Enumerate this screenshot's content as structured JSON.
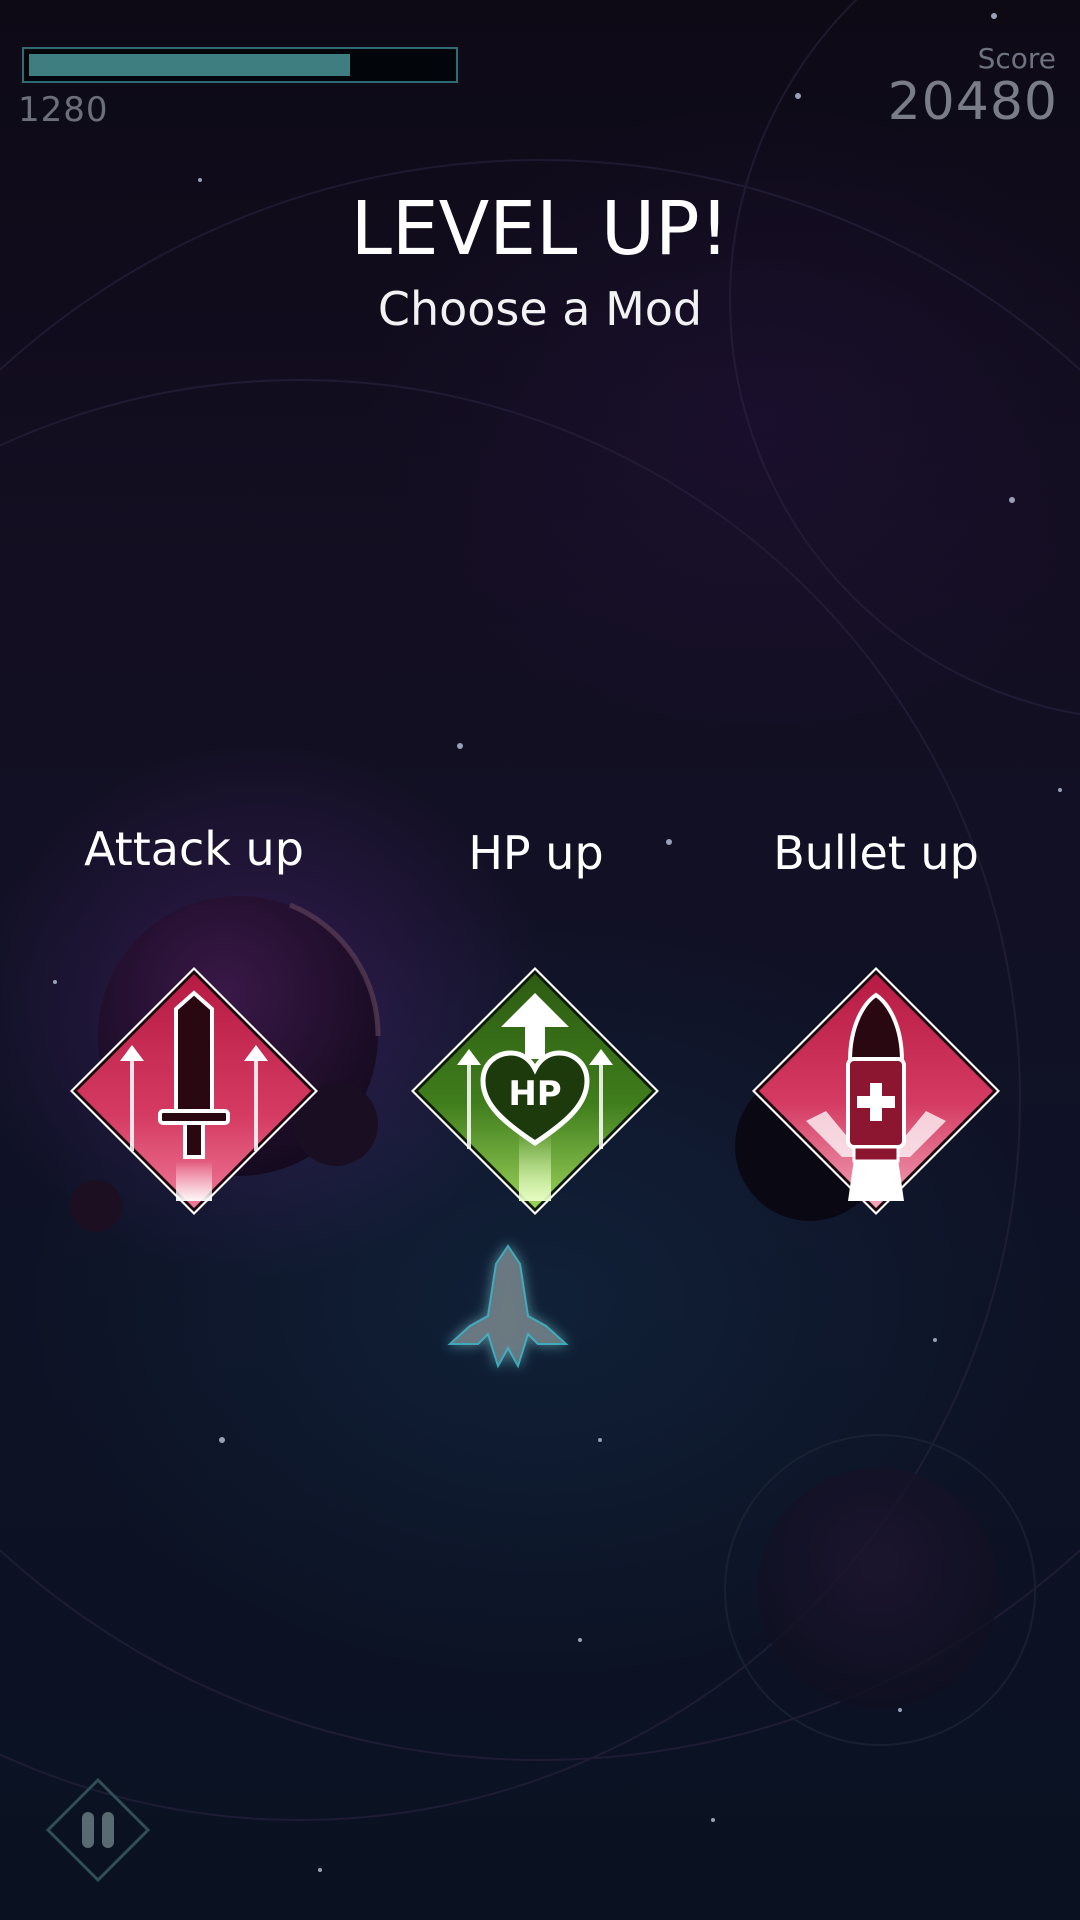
{
  "hud": {
    "hp_value": "1280",
    "hp_fill": 0.76,
    "score_label": "Score",
    "score_value": "20480"
  },
  "header": {
    "title": "LEVEL UP!",
    "subtitle": "Choose a Mod"
  },
  "mods": [
    {
      "label": "Attack up",
      "icon": "sword-icon",
      "color": "#c8284e"
    },
    {
      "label": "HP up",
      "icon": "heart-hp-icon",
      "icon_text": "HP",
      "color": "#3f7a1e"
    },
    {
      "label": "Bullet up",
      "icon": "bullet-icon",
      "color": "#c8284e"
    }
  ],
  "player": {
    "icon": "spaceship-icon"
  },
  "controls": {
    "pause_icon": "pause-icon"
  },
  "colors": {
    "hp_bar": "#3f7e80",
    "attack_card": "#c8284e",
    "hp_card": "#3f7a1e",
    "bullet_card": "#c8284e"
  }
}
